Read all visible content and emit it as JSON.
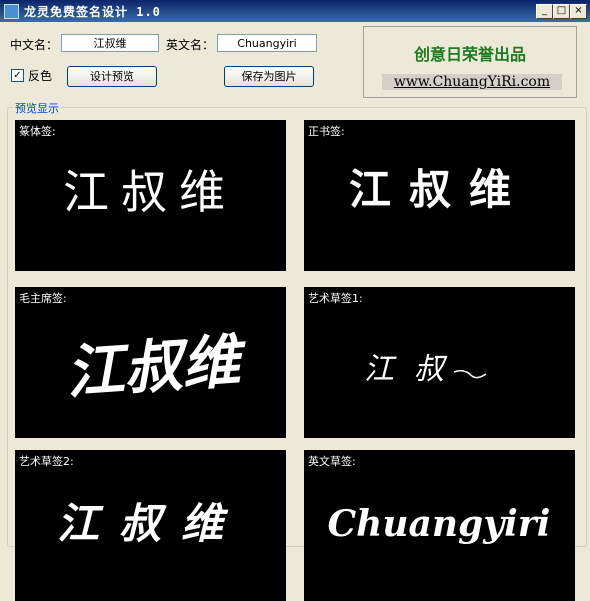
{
  "window": {
    "title": "龙灵免费签名设计 1.0",
    "controls": {
      "minimize": "_",
      "maximize": "□",
      "close": "×"
    }
  },
  "form": {
    "cn_label": "中文名：",
    "cn_value": "江叔维",
    "en_label": "英文名：",
    "en_value": "Chuangyiri",
    "invert_label": "反色",
    "invert_checked": "✓",
    "design_button": "设计预览",
    "save_button": "保存为图片"
  },
  "ad": {
    "slogan": "创意日荣誉出品",
    "url": "www.ChuangYiRi.com",
    "slogan_color": "#1e7a1e"
  },
  "preview": {
    "group_title": "预览显示",
    "cards": [
      {
        "label": "篆体签:",
        "text": "江叔维"
      },
      {
        "label": "正书签:",
        "text": "江叔维"
      },
      {
        "label": "毛主席签:",
        "text": "江叔维"
      },
      {
        "label": "艺术草签1:",
        "text": "江叔"
      },
      {
        "label": "艺术草签2:",
        "text": "江叔维"
      },
      {
        "label": "英文草签:",
        "text": "Chuangyiri"
      }
    ]
  }
}
